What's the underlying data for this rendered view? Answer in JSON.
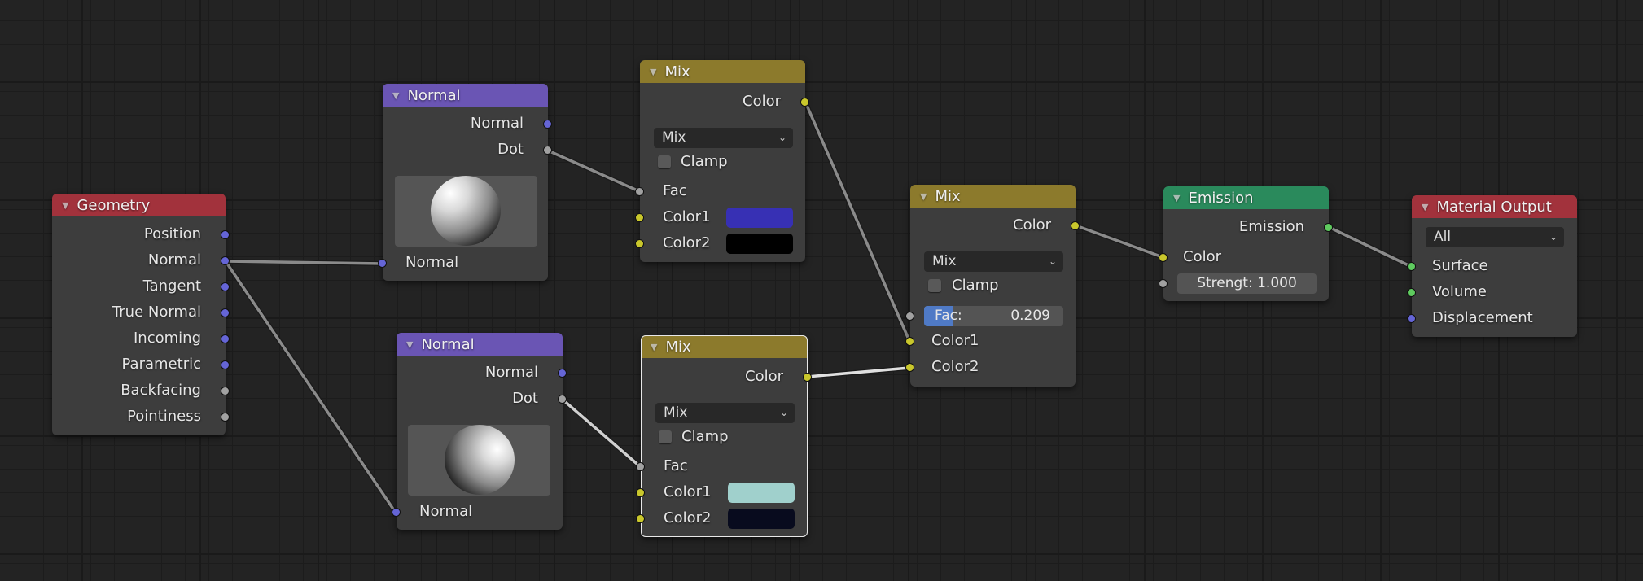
{
  "colors": {
    "socket_vector": "#6565d6",
    "socket_value": "#a1a1a1",
    "socket_color": "#c9c72c",
    "socket_shader": "#5fcb5f",
    "header_input": "#a2323c",
    "header_vector": "#6a55b4",
    "header_converter": "#8c7a2c",
    "header_shader": "#2a8a5c"
  },
  "nodes": {
    "geometry": {
      "title": "Geometry",
      "outputs": [
        "Position",
        "Normal",
        "Tangent",
        "True Normal",
        "Incoming",
        "Parametric",
        "Backfacing",
        "Pointiness"
      ]
    },
    "normal_top": {
      "title": "Normal",
      "outputs": [
        "Normal",
        "Dot"
      ],
      "input": "Normal"
    },
    "normal_bottom": {
      "title": "Normal",
      "outputs": [
        "Normal",
        "Dot"
      ],
      "input": "Normal"
    },
    "mix_top": {
      "title": "Mix",
      "output": "Color",
      "blend_type": "Mix",
      "clamp_label": "Clamp",
      "clamp_checked": false,
      "fac_label": "Fac",
      "color1_label": "Color1",
      "color1_value": "#3730b4",
      "color2_label": "Color2",
      "color2_value": "#000000"
    },
    "mix_bottom": {
      "title": "Mix",
      "selected": true,
      "output": "Color",
      "blend_type": "Mix",
      "clamp_label": "Clamp",
      "clamp_checked": false,
      "fac_label": "Fac",
      "color1_label": "Color1",
      "color1_value": "#a0d0cc",
      "color2_label": "Color2",
      "color2_value": "#080b1e"
    },
    "mix_middle": {
      "title": "Mix",
      "output": "Color",
      "blend_type": "Mix",
      "clamp_label": "Clamp",
      "clamp_checked": false,
      "fac_label": "Fac:",
      "fac_value": "0.209",
      "fac_fraction": 0.209,
      "color1_label": "Color1",
      "color2_label": "Color2"
    },
    "emission": {
      "title": "Emission",
      "output": "Emission",
      "color_label": "Color",
      "strength_label": "Strengt:",
      "strength_value": "1.000"
    },
    "material_output": {
      "title": "Material Output",
      "target": "All",
      "inputs": [
        "Surface",
        "Volume",
        "Displacement"
      ]
    }
  },
  "links": [
    {
      "from": "Geometry.Normal",
      "to": "Normal(top).Normal"
    },
    {
      "from": "Geometry.Normal",
      "to": "Normal(bottom).Normal"
    },
    {
      "from": "Normal(top).Dot",
      "to": "Mix(top).Fac"
    },
    {
      "from": "Normal(bottom).Dot",
      "to": "Mix(bottom).Fac"
    },
    {
      "from": "Mix(top).Color",
      "to": "Mix(middle).Color1"
    },
    {
      "from": "Mix(bottom).Color",
      "to": "Mix(middle).Color2"
    },
    {
      "from": "Mix(middle).Color",
      "to": "Emission.Color"
    },
    {
      "from": "Emission.Emission",
      "to": "Material Output.Surface"
    }
  ]
}
